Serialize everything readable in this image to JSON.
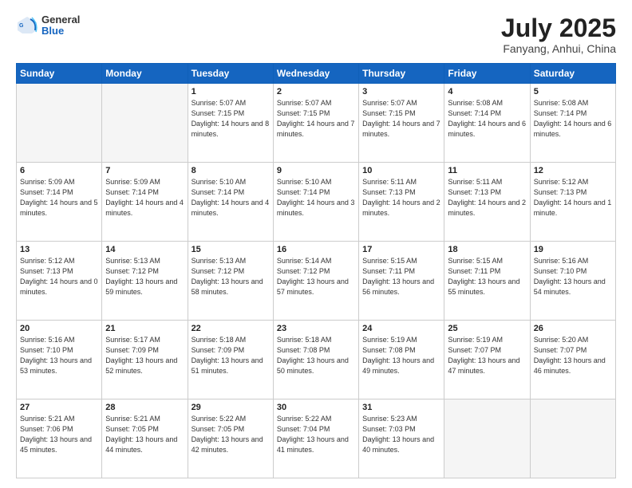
{
  "header": {
    "logo": {
      "general": "General",
      "blue": "Blue"
    },
    "title": "July 2025",
    "location": "Fanyang, Anhui, China"
  },
  "weekdays": [
    "Sunday",
    "Monday",
    "Tuesday",
    "Wednesday",
    "Thursday",
    "Friday",
    "Saturday"
  ],
  "weeks": [
    [
      {
        "day": "",
        "sunrise": "",
        "sunset": "",
        "daylight": ""
      },
      {
        "day": "",
        "sunrise": "",
        "sunset": "",
        "daylight": ""
      },
      {
        "day": "1",
        "sunrise": "Sunrise: 5:07 AM",
        "sunset": "Sunset: 7:15 PM",
        "daylight": "Daylight: 14 hours and 8 minutes."
      },
      {
        "day": "2",
        "sunrise": "Sunrise: 5:07 AM",
        "sunset": "Sunset: 7:15 PM",
        "daylight": "Daylight: 14 hours and 7 minutes."
      },
      {
        "day": "3",
        "sunrise": "Sunrise: 5:07 AM",
        "sunset": "Sunset: 7:15 PM",
        "daylight": "Daylight: 14 hours and 7 minutes."
      },
      {
        "day": "4",
        "sunrise": "Sunrise: 5:08 AM",
        "sunset": "Sunset: 7:14 PM",
        "daylight": "Daylight: 14 hours and 6 minutes."
      },
      {
        "day": "5",
        "sunrise": "Sunrise: 5:08 AM",
        "sunset": "Sunset: 7:14 PM",
        "daylight": "Daylight: 14 hours and 6 minutes."
      }
    ],
    [
      {
        "day": "6",
        "sunrise": "Sunrise: 5:09 AM",
        "sunset": "Sunset: 7:14 PM",
        "daylight": "Daylight: 14 hours and 5 minutes."
      },
      {
        "day": "7",
        "sunrise": "Sunrise: 5:09 AM",
        "sunset": "Sunset: 7:14 PM",
        "daylight": "Daylight: 14 hours and 4 minutes."
      },
      {
        "day": "8",
        "sunrise": "Sunrise: 5:10 AM",
        "sunset": "Sunset: 7:14 PM",
        "daylight": "Daylight: 14 hours and 4 minutes."
      },
      {
        "day": "9",
        "sunrise": "Sunrise: 5:10 AM",
        "sunset": "Sunset: 7:14 PM",
        "daylight": "Daylight: 14 hours and 3 minutes."
      },
      {
        "day": "10",
        "sunrise": "Sunrise: 5:11 AM",
        "sunset": "Sunset: 7:13 PM",
        "daylight": "Daylight: 14 hours and 2 minutes."
      },
      {
        "day": "11",
        "sunrise": "Sunrise: 5:11 AM",
        "sunset": "Sunset: 7:13 PM",
        "daylight": "Daylight: 14 hours and 2 minutes."
      },
      {
        "day": "12",
        "sunrise": "Sunrise: 5:12 AM",
        "sunset": "Sunset: 7:13 PM",
        "daylight": "Daylight: 14 hours and 1 minute."
      }
    ],
    [
      {
        "day": "13",
        "sunrise": "Sunrise: 5:12 AM",
        "sunset": "Sunset: 7:13 PM",
        "daylight": "Daylight: 14 hours and 0 minutes."
      },
      {
        "day": "14",
        "sunrise": "Sunrise: 5:13 AM",
        "sunset": "Sunset: 7:12 PM",
        "daylight": "Daylight: 13 hours and 59 minutes."
      },
      {
        "day": "15",
        "sunrise": "Sunrise: 5:13 AM",
        "sunset": "Sunset: 7:12 PM",
        "daylight": "Daylight: 13 hours and 58 minutes."
      },
      {
        "day": "16",
        "sunrise": "Sunrise: 5:14 AM",
        "sunset": "Sunset: 7:12 PM",
        "daylight": "Daylight: 13 hours and 57 minutes."
      },
      {
        "day": "17",
        "sunrise": "Sunrise: 5:15 AM",
        "sunset": "Sunset: 7:11 PM",
        "daylight": "Daylight: 13 hours and 56 minutes."
      },
      {
        "day": "18",
        "sunrise": "Sunrise: 5:15 AM",
        "sunset": "Sunset: 7:11 PM",
        "daylight": "Daylight: 13 hours and 55 minutes."
      },
      {
        "day": "19",
        "sunrise": "Sunrise: 5:16 AM",
        "sunset": "Sunset: 7:10 PM",
        "daylight": "Daylight: 13 hours and 54 minutes."
      }
    ],
    [
      {
        "day": "20",
        "sunrise": "Sunrise: 5:16 AM",
        "sunset": "Sunset: 7:10 PM",
        "daylight": "Daylight: 13 hours and 53 minutes."
      },
      {
        "day": "21",
        "sunrise": "Sunrise: 5:17 AM",
        "sunset": "Sunset: 7:09 PM",
        "daylight": "Daylight: 13 hours and 52 minutes."
      },
      {
        "day": "22",
        "sunrise": "Sunrise: 5:18 AM",
        "sunset": "Sunset: 7:09 PM",
        "daylight": "Daylight: 13 hours and 51 minutes."
      },
      {
        "day": "23",
        "sunrise": "Sunrise: 5:18 AM",
        "sunset": "Sunset: 7:08 PM",
        "daylight": "Daylight: 13 hours and 50 minutes."
      },
      {
        "day": "24",
        "sunrise": "Sunrise: 5:19 AM",
        "sunset": "Sunset: 7:08 PM",
        "daylight": "Daylight: 13 hours and 49 minutes."
      },
      {
        "day": "25",
        "sunrise": "Sunrise: 5:19 AM",
        "sunset": "Sunset: 7:07 PM",
        "daylight": "Daylight: 13 hours and 47 minutes."
      },
      {
        "day": "26",
        "sunrise": "Sunrise: 5:20 AM",
        "sunset": "Sunset: 7:07 PM",
        "daylight": "Daylight: 13 hours and 46 minutes."
      }
    ],
    [
      {
        "day": "27",
        "sunrise": "Sunrise: 5:21 AM",
        "sunset": "Sunset: 7:06 PM",
        "daylight": "Daylight: 13 hours and 45 minutes."
      },
      {
        "day": "28",
        "sunrise": "Sunrise: 5:21 AM",
        "sunset": "Sunset: 7:05 PM",
        "daylight": "Daylight: 13 hours and 44 minutes."
      },
      {
        "day": "29",
        "sunrise": "Sunrise: 5:22 AM",
        "sunset": "Sunset: 7:05 PM",
        "daylight": "Daylight: 13 hours and 42 minutes."
      },
      {
        "day": "30",
        "sunrise": "Sunrise: 5:22 AM",
        "sunset": "Sunset: 7:04 PM",
        "daylight": "Daylight: 13 hours and 41 minutes."
      },
      {
        "day": "31",
        "sunrise": "Sunrise: 5:23 AM",
        "sunset": "Sunset: 7:03 PM",
        "daylight": "Daylight: 13 hours and 40 minutes."
      },
      {
        "day": "",
        "sunrise": "",
        "sunset": "",
        "daylight": ""
      },
      {
        "day": "",
        "sunrise": "",
        "sunset": "",
        "daylight": ""
      }
    ]
  ]
}
